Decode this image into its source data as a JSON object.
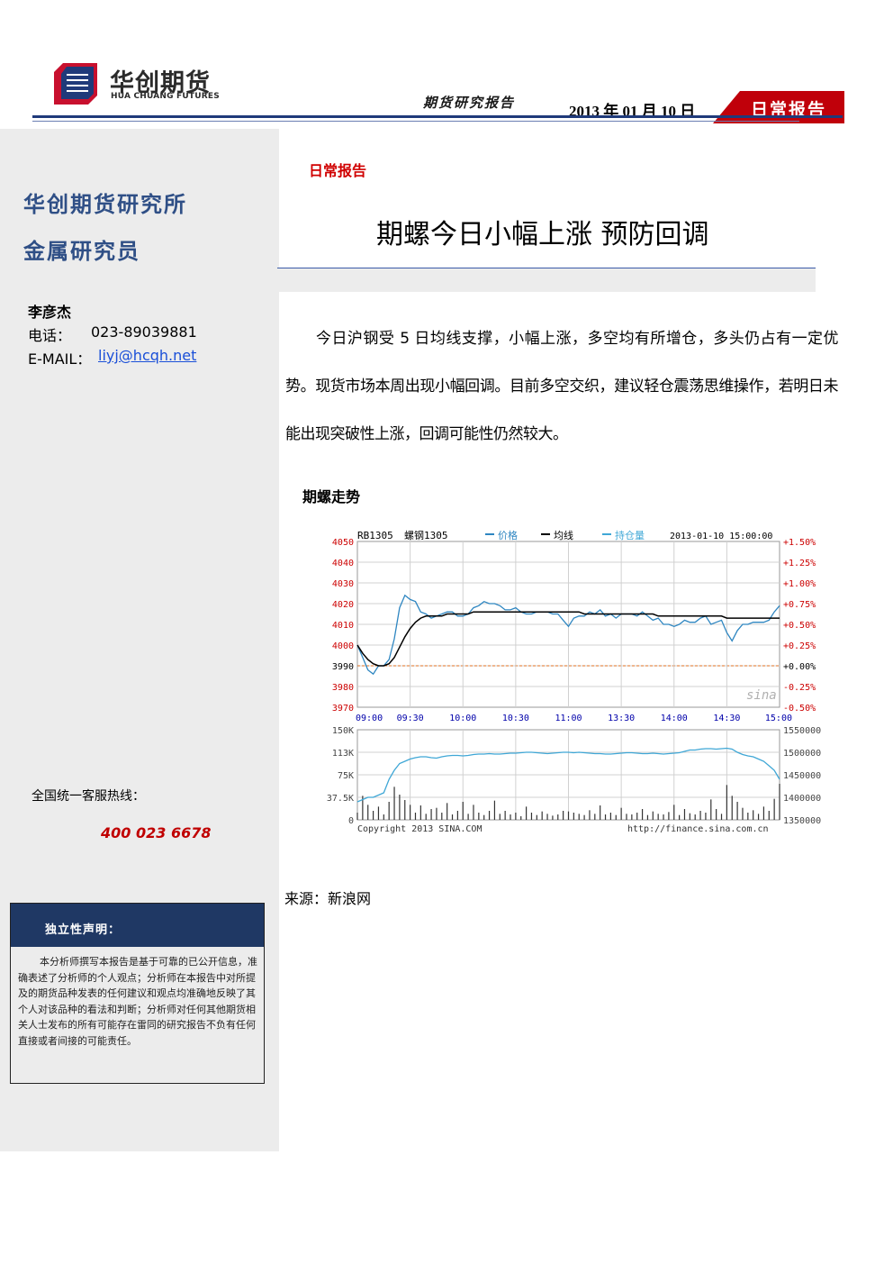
{
  "header": {
    "brand_cn": "华创期货",
    "brand_en": "HUA CHUANG FUTURES",
    "report_type": "期货研究报告",
    "date": "2013 年 01 月 10 日",
    "tab_label": "日常报告",
    "accent_color": "#1f3a7a",
    "tab_color": "#c0000a"
  },
  "sidebar": {
    "institute": "华创期货研究所",
    "role": "金属研究员",
    "author": "李彦杰",
    "phone_label": "电话：",
    "phone": "023-89039881",
    "email_label": "E-MAIL：",
    "email": "liyj@hcqh.net",
    "hotline_label": "全国统一客服热线：",
    "hotline": "400 023 6678",
    "disclaimer_title": "独立性声明：",
    "disclaimer_text": "本分析师撰写本报告是基于可靠的已公开信息，准确表述了分析师的个人观点；分析师在本报告中对所提及的期货品种发表的任何建议和观点均准确地反映了其个人对该品种的看法和判断；分析师对任何其他期货相关人士发布的所有可能存在雷同的研究报告不负有任何直接或者间接的可能责任。"
  },
  "main": {
    "category": "日常报告",
    "title": "期螺今日小幅上涨  预防回调",
    "paragraph": "今日沪钢受 5 日均线支撑，小幅上涨，多空均有所增仓，多头仍占有一定优势。现货市场本周出现小幅回调。目前多空交织，建议轻仓震荡思维操作，若明日未能出现突破性上涨，回调可能性仍然较大。",
    "chart_title": "期螺走势",
    "source": "来源：新浪网"
  },
  "chart_data": {
    "type": "line",
    "code": "RB1305",
    "name": "螺钢1305",
    "timestamp": "2013-01-10 15:00:00",
    "legend": [
      "价格",
      "均线",
      "持仓量"
    ],
    "colors": {
      "price": "#2e86c1",
      "avg": "#000000",
      "oi": "#3fa7d6",
      "volume": "#333333",
      "left_axis": "#cc0000",
      "right_axis": "#cc0000",
      "ref": "#e07020"
    },
    "ref_price": 3990,
    "price_ylim": [
      3970,
      4050
    ],
    "price_ticks": [
      "4050",
      "4040",
      "4030",
      "4020",
      "4010",
      "4000",
      "3990",
      "3980",
      "3970"
    ],
    "pct_ticks": [
      "+1.50%",
      "+1.25%",
      "+1.00%",
      "+0.75%",
      "+0.50%",
      "+0.25%",
      "+0.00%",
      "-0.25%",
      "-0.50%"
    ],
    "time_ticks": [
      "09:00",
      "09:30",
      "10:00",
      "10:30",
      "11:00",
      "13:30",
      "14:00",
      "14:30",
      "15:00"
    ],
    "x": [
      0,
      3,
      6,
      9,
      12,
      15,
      18,
      21,
      24,
      27,
      30,
      33,
      36,
      39,
      42,
      45,
      48,
      51,
      54,
      57,
      60,
      63,
      66,
      69,
      72,
      75,
      78,
      81,
      84,
      87,
      90,
      93,
      96,
      99,
      102,
      105,
      108,
      111,
      114,
      117,
      120,
      123,
      126,
      129,
      132,
      135,
      138,
      141,
      144,
      147,
      150,
      153,
      156,
      159,
      162,
      165,
      168,
      171,
      174,
      177,
      180,
      183,
      186,
      189,
      192,
      195,
      198,
      201,
      204,
      207,
      210,
      213,
      216,
      219,
      222,
      225,
      228,
      231,
      234,
      237,
      240
    ],
    "price": [
      4000,
      3994,
      3988,
      3986,
      3990,
      3990,
      3993,
      4003,
      4018,
      4024,
      4022,
      4021,
      4016,
      4015,
      4013,
      4014,
      4015,
      4016,
      4016,
      4014,
      4014,
      4015,
      4018,
      4019,
      4021,
      4020,
      4020,
      4019,
      4017,
      4017,
      4018,
      4016,
      4015,
      4015,
      4016,
      4016,
      4016,
      4015,
      4015,
      4012,
      4009,
      4013,
      4014,
      4014,
      4016,
      4015,
      4017,
      4014,
      4015,
      4013,
      4015,
      4015,
      4015,
      4014,
      4016,
      4014,
      4012,
      4013,
      4010,
      4010,
      4009,
      4010,
      4012,
      4011,
      4011,
      4013,
      4014,
      4010,
      4011,
      4012,
      4006,
      4002,
      4007,
      4010,
      4010,
      4011,
      4011,
      4011,
      4012,
      4016,
      4019
    ],
    "avg": [
      4000,
      3996,
      3993,
      3991,
      3990,
      3990,
      3991,
      3994,
      3999,
      4004,
      4008,
      4011,
      4013,
      4014,
      4014,
      4014,
      4014,
      4015,
      4015,
      4015,
      4015,
      4015,
      4016,
      4016,
      4016,
      4016,
      4016,
      4016,
      4016,
      4016,
      4016,
      4016,
      4016,
      4016,
      4016,
      4016,
      4016,
      4016,
      4016,
      4016,
      4016,
      4016,
      4016,
      4015,
      4015,
      4015,
      4015,
      4015,
      4015,
      4015,
      4015,
      4015,
      4015,
      4015,
      4015,
      4015,
      4015,
      4014,
      4014,
      4014,
      4014,
      4014,
      4014,
      4014,
      4014,
      4014,
      4014,
      4014,
      4014,
      4014,
      4013,
      4013,
      4013,
      4013,
      4013,
      4013,
      4013,
      4013,
      4013,
      4013,
      4013
    ],
    "volume_ylim": [
      0,
      150000
    ],
    "volume_ticks": [
      "150K",
      "113K",
      "75K",
      "37.5K",
      "0"
    ],
    "oi_ylim": [
      1350000,
      1550000
    ],
    "oi_ticks": [
      "1550000",
      "1500000",
      "1450000",
      "1400000",
      "1350000"
    ],
    "oi": [
      1390000,
      1395000,
      1400000,
      1400000,
      1405000,
      1410000,
      1440000,
      1460000,
      1475000,
      1480000,
      1485000,
      1488000,
      1490000,
      1490000,
      1488000,
      1487000,
      1490000,
      1492000,
      1493000,
      1493000,
      1492000,
      1493000,
      1495000,
      1496000,
      1496000,
      1497000,
      1496000,
      1496000,
      1497000,
      1498000,
      1498000,
      1499000,
      1500000,
      1500000,
      1499000,
      1498000,
      1497000,
      1498000,
      1499000,
      1500000,
      1500000,
      1499000,
      1500000,
      1499000,
      1498000,
      1497000,
      1497000,
      1496000,
      1496000,
      1497000,
      1498000,
      1499000,
      1499000,
      1498000,
      1497000,
      1497000,
      1498000,
      1497000,
      1496000,
      1497000,
      1498000,
      1499000,
      1502000,
      1505000,
      1505000,
      1507000,
      1508000,
      1508000,
      1507000,
      1508000,
      1509000,
      1507000,
      1500000,
      1495000,
      1492000,
      1490000,
      1485000,
      1480000,
      1470000,
      1460000,
      1440000
    ],
    "volume": [
      12000,
      40000,
      25000,
      15000,
      22000,
      9000,
      30000,
      55000,
      42000,
      33000,
      25000,
      12000,
      24000,
      10000,
      18000,
      20000,
      12000,
      28000,
      9000,
      15000,
      30000,
      10000,
      25000,
      12000,
      8000,
      15000,
      32000,
      10000,
      15000,
      9000,
      12000,
      6000,
      22000,
      12000,
      8000,
      14000,
      10000,
      7000,
      9000,
      15000,
      14000,
      12000,
      10000,
      8000,
      16000,
      10000,
      24000,
      9000,
      12000,
      8000,
      20000,
      10000,
      9000,
      12000,
      18000,
      8000,
      14000,
      10000,
      9000,
      13000,
      25000,
      8000,
      18000,
      11000,
      9000,
      15000,
      12000,
      34000,
      18000,
      10000,
      58000,
      40000,
      30000,
      20000,
      12000,
      16000,
      10000,
      22000,
      15000,
      35000,
      60000
    ],
    "copyright": "Copyright 2013 SINA.COM",
    "url": "http://finance.sina.com.cn",
    "watermark": "sina"
  }
}
